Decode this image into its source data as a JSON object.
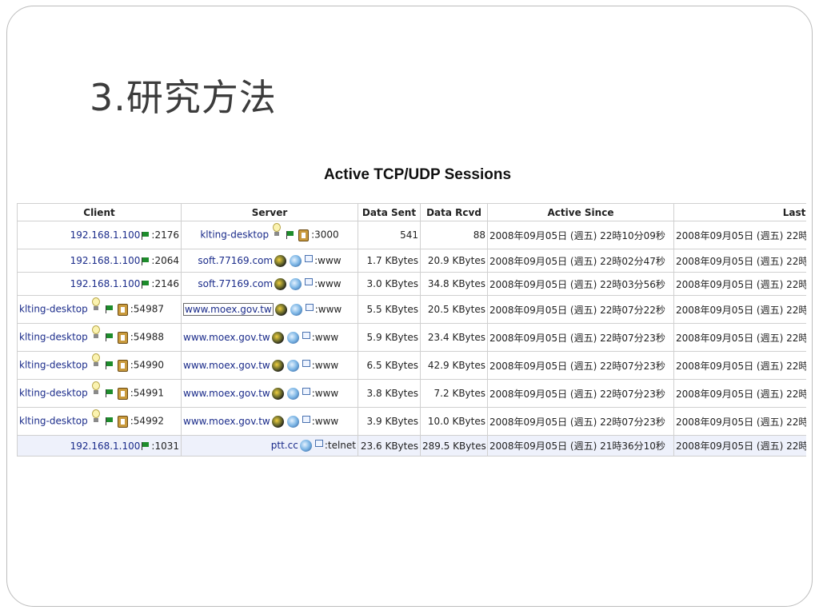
{
  "slide": {
    "title": "3.研究方法"
  },
  "table": {
    "heading": "Active TCP/UDP Sessions",
    "columns": [
      "Client",
      "Server",
      "Data Sent",
      "Data Rcvd",
      "Active Since",
      "Last Seen"
    ],
    "rows": [
      {
        "client": "192.168.1.100",
        "client_port": ":2176",
        "server": "klting-desktop",
        "server_port": ":3000",
        "sent": "541",
        "rcvd": "88",
        "since": "2008年09月05日 (週五) 22時10分09秒",
        "last": "2008年09月05日 (週五) 22時"
      },
      {
        "client": "192.168.1.100",
        "client_port": ":2064",
        "server": "soft.77169.com",
        "server_port": ":www",
        "sent": "1.7 KBytes",
        "rcvd": "20.9 KBytes",
        "since": "2008年09月05日 (週五) 22時02分47秒",
        "last": "2008年09月05日 (週五) 22時"
      },
      {
        "client": "192.168.1.100",
        "client_port": ":2146",
        "server": "soft.77169.com",
        "server_port": ":www",
        "sent": "3.0 KBytes",
        "rcvd": "34.8 KBytes",
        "since": "2008年09月05日 (週五) 22時03分56秒",
        "last": "2008年09月05日 (週五) 22時"
      },
      {
        "client": "klting-desktop",
        "client_port": ":54987",
        "server": "www.moex.gov.tw",
        "server_port": ":www",
        "sent": "5.5 KBytes",
        "rcvd": "20.5 KBytes",
        "since": "2008年09月05日 (週五) 22時07分22秒",
        "last": "2008年09月05日 (週五) 22時"
      },
      {
        "client": "klting-desktop",
        "client_port": ":54988",
        "server": "www.moex.gov.tw",
        "server_port": ":www",
        "sent": "5.9 KBytes",
        "rcvd": "23.4 KBytes",
        "since": "2008年09月05日 (週五) 22時07分23秒",
        "last": "2008年09月05日 (週五) 22時"
      },
      {
        "client": "klting-desktop",
        "client_port": ":54990",
        "server": "www.moex.gov.tw",
        "server_port": ":www",
        "sent": "6.5 KBytes",
        "rcvd": "42.9 KBytes",
        "since": "2008年09月05日 (週五) 22時07分23秒",
        "last": "2008年09月05日 (週五) 22時"
      },
      {
        "client": "klting-desktop",
        "client_port": ":54991",
        "server": "www.moex.gov.tw",
        "server_port": ":www",
        "sent": "3.8 KBytes",
        "rcvd": "7.2 KBytes",
        "since": "2008年09月05日 (週五) 22時07分23秒",
        "last": "2008年09月05日 (週五) 22時"
      },
      {
        "client": "klting-desktop",
        "client_port": ":54992",
        "server": "www.moex.gov.tw",
        "server_port": ":www",
        "sent": "3.9 KBytes",
        "rcvd": "10.0 KBytes",
        "since": "2008年09月05日 (週五) 22時07分23秒",
        "last": "2008年09月05日 (週五) 22時"
      },
      {
        "client": "192.168.1.100",
        "client_port": ":1031",
        "server": "ptt.cc",
        "server_port": ":telnet",
        "sent": "23.6 KBytes",
        "rcvd": "289.5 KBytes",
        "since": "2008年09月05日 (週五) 21時36分10秒",
        "last": "2008年09月05日 (週五) 22時"
      }
    ]
  },
  "icons": {
    "flag": "flag-icon",
    "bulb": "lightbulb-icon",
    "box": "box-icon",
    "globe_dark": "globe-dark-icon",
    "globe_blue": "globe-blue-icon",
    "external": "external-link-icon"
  },
  "colors": {
    "link": "#1a2b8a",
    "flag": "#1e8c2c",
    "last_row_bg": "#eef1fb"
  }
}
